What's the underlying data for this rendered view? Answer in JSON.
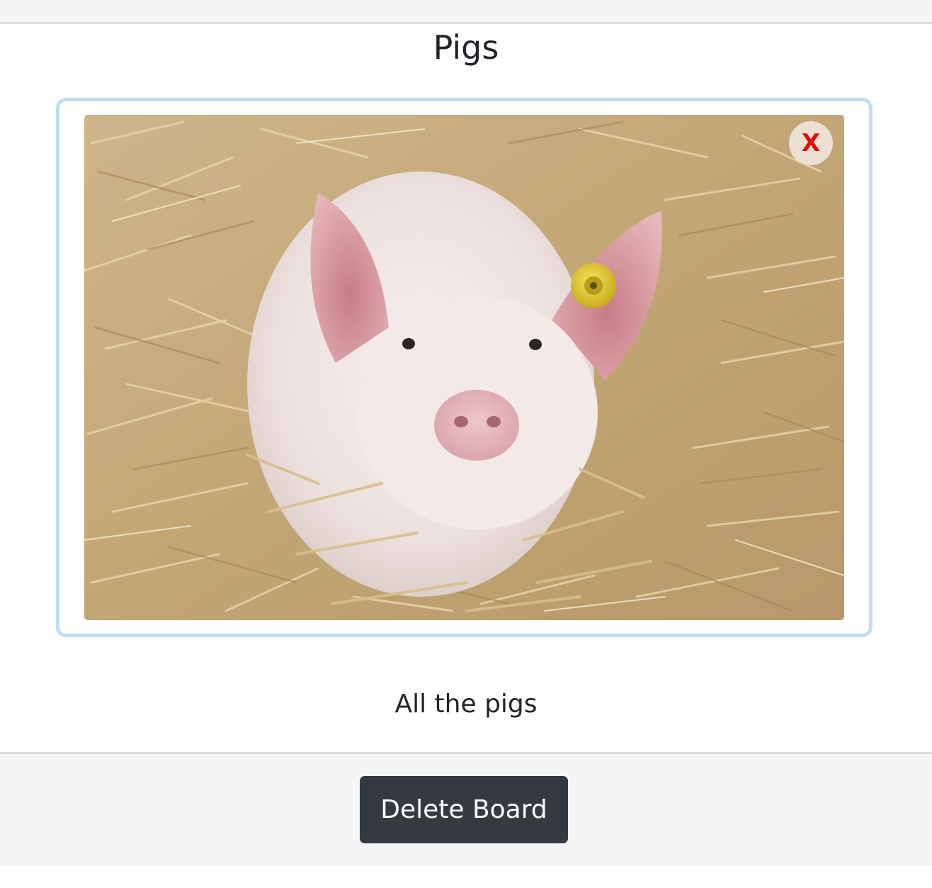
{
  "board": {
    "title": "Pigs",
    "description": "All the pigs"
  },
  "pin": {
    "image_alt": "Pig lying in straw",
    "remove_label": "X"
  },
  "footer": {
    "delete_label": "Delete Board"
  },
  "colors": {
    "frame_border": "#bfdcfa",
    "remove_x": "#e00d0d",
    "delete_button_bg": "#343a40",
    "strip_bg": "#f5f5f5"
  }
}
